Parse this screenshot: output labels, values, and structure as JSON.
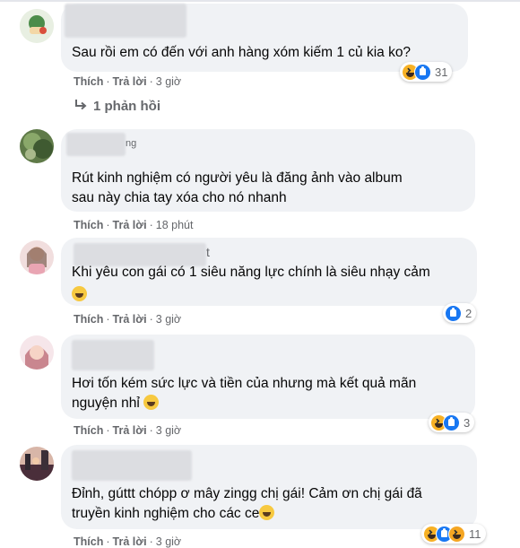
{
  "comments": [
    {
      "text": "Sau rồi em có đến với anh hàng xóm kiếm 1 củ kia ko?",
      "like_label": "Thích",
      "reply_label": "Trả lời",
      "time": "3 giờ",
      "reaction_count": "31",
      "reactions": [
        "haha",
        "like"
      ],
      "replies_label": "1 phản hồi"
    },
    {
      "name_fragment": "ng",
      "text_line1": "Rút kinh nghiệm có người yêu là đăng ảnh vào album",
      "text_line2": "sau này chia tay xóa cho nó nhanh",
      "like_label": "Thích",
      "reply_label": "Trả lời",
      "time": "18 phút"
    },
    {
      "name_fragment": "t",
      "text": "Khi yêu con gái có 1 siêu năng lực chính là siêu nhạy cảm",
      "like_label": "Thích",
      "reply_label": "Trả lời",
      "time": "3 giờ",
      "reaction_count": "2",
      "reactions": [
        "like"
      ]
    },
    {
      "text_line1": "Hơi tốn kém sức lực và tiền của nhưng mà kết quả mãn",
      "text_line2": "nguyện nhỉ",
      "like_label": "Thích",
      "reply_label": "Trả lời",
      "time": "3 giờ",
      "reaction_count": "3",
      "reactions": [
        "haha",
        "like"
      ]
    },
    {
      "text_line1": "Đỉnh, gúttt chópp ơ mây zingg chị gái! Cảm ơn chị gái đã",
      "text_line2": "truyền kinh nghiệm cho các ce",
      "like_label": "Thích",
      "reply_label": "Trả lời",
      "time": "3 giờ",
      "reaction_count": "11",
      "reactions": [
        "haha",
        "like"
      ]
    }
  ],
  "colors": {
    "bubble": "#f0f2f5",
    "meta_text": "#65676b",
    "like_blue": "#1877f2",
    "haha_yellow": "#f7b125"
  }
}
